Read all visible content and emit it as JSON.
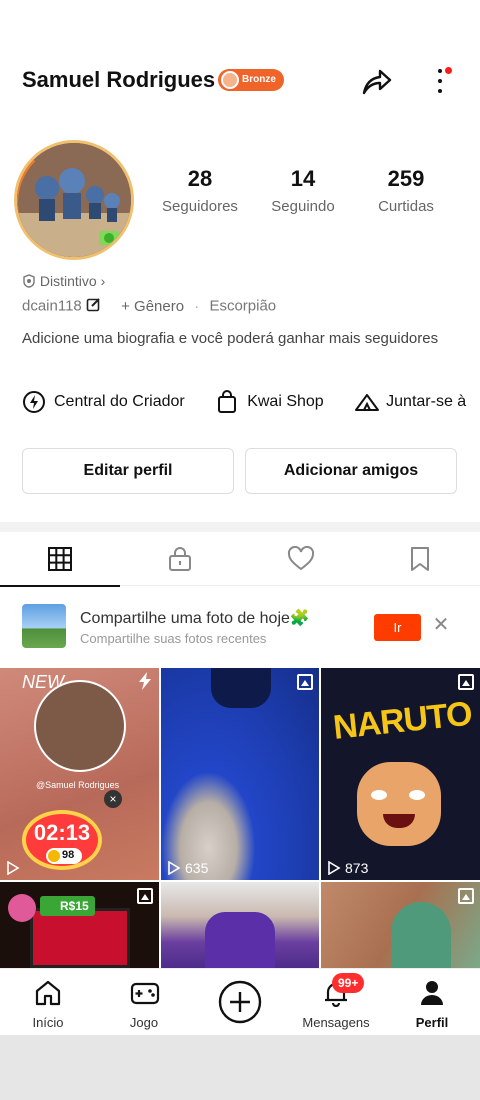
{
  "header": {
    "name": "Samuel Rodrigues",
    "badge": "Bronze"
  },
  "stats": [
    {
      "value": "28",
      "label": "Seguidores"
    },
    {
      "value": "14",
      "label": "Seguindo"
    },
    {
      "value": "259",
      "label": "Curtidas"
    }
  ],
  "profile": {
    "distintivo": "Distintivo",
    "user_id": "dcain118",
    "gender": "+ Gênero",
    "separator": "·",
    "sign": "Escorpião",
    "bio": "Adicione uma biografia e você poderá ganhar mais seguidores"
  },
  "links": [
    {
      "label": "Central do Criador",
      "icon": "lightning-icon"
    },
    {
      "label": "Kwai Shop",
      "icon": "shopping-bag-icon"
    },
    {
      "label": "Juntar-se à",
      "icon": "tent-icon"
    }
  ],
  "buttons": {
    "edit": "Editar perfil",
    "add_friends": "Adicionar amigos"
  },
  "tabs": [
    "grid-icon",
    "lock-icon",
    "heart-icon",
    "bookmark-icon"
  ],
  "banner": {
    "title": "Compartilhe uma foto de hoje🧩",
    "subtitle": "Compartilhe suas fotos recentes",
    "button": "Ir",
    "close": "✕"
  },
  "posts": [
    {
      "views": "",
      "overlay_user": "@Samuel Rodrigues",
      "timer": "02:13",
      "coins": "98",
      "new": "NEW"
    },
    {
      "views": "635"
    },
    {
      "views": "873",
      "title": "NARUTO"
    },
    {
      "money": "R$15"
    },
    {},
    {}
  ],
  "nav": [
    {
      "label": "Início",
      "icon": "home-icon"
    },
    {
      "label": "Jogo",
      "icon": "gamepad-icon"
    },
    {
      "label": "",
      "icon": "plus-circle-icon"
    },
    {
      "label": "Mensagens",
      "icon": "bell-icon",
      "badge": "99+"
    },
    {
      "label": "Perfil",
      "icon": "person-icon"
    }
  ],
  "colors": {
    "accent": "#fe3c00",
    "badge": "#f0642a",
    "notification": "#ff2d2d"
  }
}
